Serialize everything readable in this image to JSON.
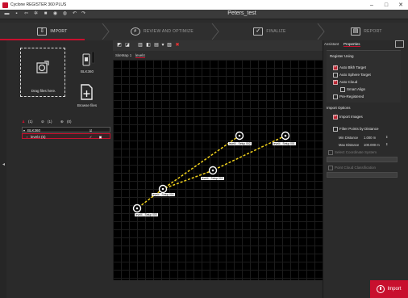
{
  "window": {
    "title": "Cyclone REGISTER 360 PLUS",
    "controls": [
      "–",
      "□",
      "✕"
    ]
  },
  "project_title": "Peters_test",
  "workflow": {
    "tabs": [
      {
        "label": "IMPORT",
        "icon": "import-icon",
        "active": true
      },
      {
        "label": "REVIEW AND OPTIMIZE",
        "icon": "review-icon",
        "active": false
      },
      {
        "label": "FINALIZE",
        "icon": "finalize-icon",
        "active": false
      },
      {
        "label": "REPORT",
        "icon": "report-icon",
        "active": false
      }
    ]
  },
  "left_panel": {
    "drop_label": "Drag files here.",
    "device_label": "BLK360",
    "browse_label": "Browse files",
    "tree_tabs": [
      "(1)",
      "(1)",
      "(0)"
    ],
    "tree": [
      {
        "label": "BLK360",
        "checked": true
      },
      {
        "label": "level4 (5)",
        "checked": true
      }
    ]
  },
  "center": {
    "tabs": [
      "SiteMap 1",
      "level4"
    ],
    "nodes": [
      {
        "label": "level4 - Setup 002"
      },
      {
        "label": "level4 - Setup 001"
      },
      {
        "label": "level4 - Setup 003"
      },
      {
        "label": "level4 - Setup 004"
      },
      {
        "label": "level4 - Setup 005"
      }
    ]
  },
  "right_panel": {
    "tabs": [
      "Assistant",
      "Properties"
    ],
    "register_using": {
      "title": "Register Using",
      "options": [
        {
          "label": "Auto Blkh Target",
          "checked": true
        },
        {
          "label": "Auto Sphere Target",
          "checked": false
        },
        {
          "label": "Auto Cloud",
          "checked": true
        },
        {
          "label": "Smart Align",
          "checked": false
        },
        {
          "label": "Pre-Registered",
          "checked": false
        }
      ]
    },
    "import_options": {
      "title": "Import Options",
      "import_images": {
        "label": "Import Images",
        "checked": true
      },
      "filter_points": {
        "label": "Filter Points by Distance",
        "checked": false
      },
      "min_distance_label": "Min Distance",
      "min_distance_value": "1.000 m",
      "max_distance_label": "Max Distance",
      "max_distance_value": "100.000 m",
      "coord_system_label": "Select Coordinate System",
      "point_cloud_label": "Point Cloud Classification"
    },
    "import_button": "Import"
  },
  "colors": {
    "accent": "#c8102e",
    "viewport_bg": "#000000",
    "path": "#f2d21b"
  }
}
